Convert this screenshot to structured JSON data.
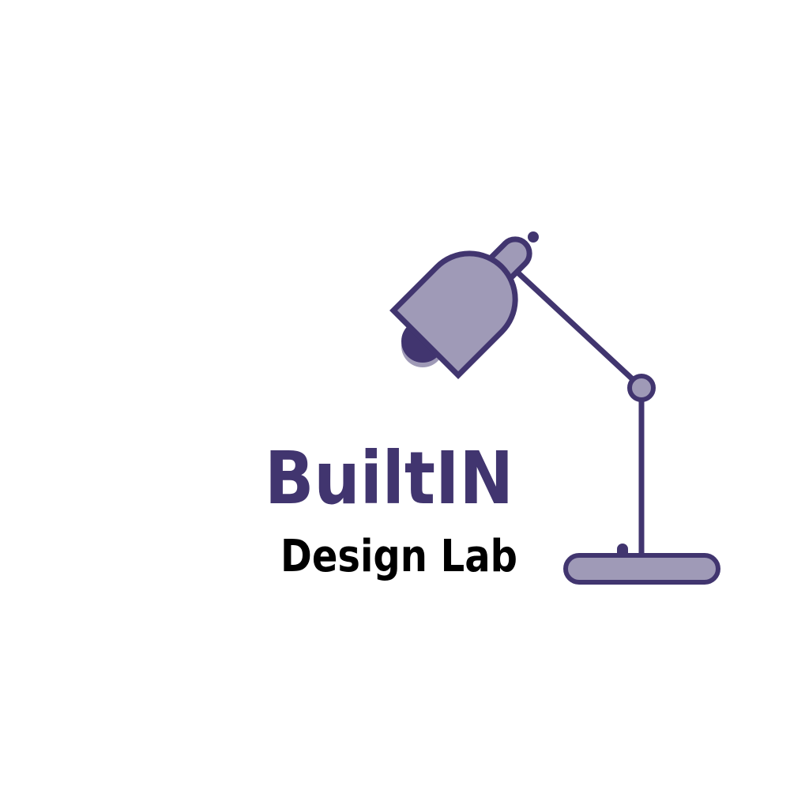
{
  "logo": {
    "brand_name": "BuiltIN",
    "tagline": "Design Lab",
    "icon": "desk-lamp-icon"
  },
  "colors": {
    "primary_dark": "#41356f",
    "primary_light": "#9f9ab7",
    "tagline": "#000000",
    "background": "#ffffff"
  }
}
